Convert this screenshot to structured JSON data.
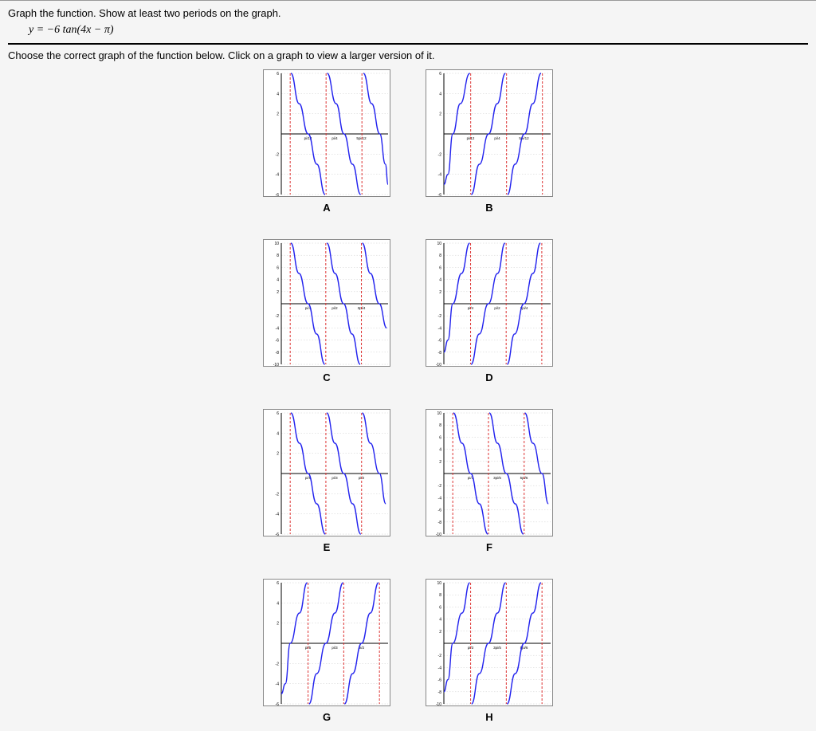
{
  "question": {
    "prompt": "Graph the function. Show at least two periods on the graph.",
    "formula_prefix": "y = ",
    "formula_tan": "−6 tan(4x − π)",
    "instruction": "Choose the correct graph of the function below. Click on a graph to view a larger version of it."
  },
  "options": {
    "A": {
      "label": "A"
    },
    "B": {
      "label": "B"
    },
    "C": {
      "label": "C"
    },
    "D": {
      "label": "D"
    },
    "E": {
      "label": "E"
    },
    "F": {
      "label": "F"
    },
    "G": {
      "label": "G"
    },
    "H": {
      "label": "H"
    }
  },
  "chart_data": [
    {
      "id": "A",
      "type": "line",
      "title": "",
      "xlabel": "",
      "ylabel": "",
      "xlim": [
        0,
        0.78
      ],
      "ylim": [
        -6,
        6
      ],
      "x_ticks": [
        "pi/12",
        "pi/4",
        "5pi/12"
      ],
      "y_ticks": [
        -6,
        -4,
        -2,
        2,
        4,
        6
      ],
      "asymptotes_x": [
        0.065,
        0.327,
        0.589
      ],
      "direction": "decreasing",
      "series": [
        {
          "name": "tan-branch-1",
          "x": [
            0.07,
            0.13,
            0.196,
            0.26,
            0.32
          ],
          "y": [
            6,
            3,
            0,
            -3,
            -6
          ]
        },
        {
          "name": "tan-branch-2",
          "x": [
            0.335,
            0.4,
            0.458,
            0.52,
            0.58
          ],
          "y": [
            6,
            3,
            0,
            -3,
            -6
          ]
        },
        {
          "name": "tan-branch-3",
          "x": [
            0.6,
            0.66,
            0.72,
            0.76,
            0.78
          ],
          "y": [
            6,
            3,
            0,
            -3,
            -5
          ]
        }
      ]
    },
    {
      "id": "B",
      "type": "line",
      "xlim": [
        0,
        0.78
      ],
      "ylim": [
        -6,
        6
      ],
      "x_ticks": [
        "pi/12",
        "pi/4",
        "5pi/12"
      ],
      "y_ticks": [
        -6,
        -4,
        -2,
        2,
        4,
        6
      ],
      "asymptotes_x": [
        0.196,
        0.458,
        0.72
      ],
      "direction": "increasing",
      "series": [
        {
          "name": "tan-branch-0",
          "x": [
            0.0,
            0.03,
            0.065,
            0.12,
            0.19
          ],
          "y": [
            -5,
            -4,
            0,
            3,
            6
          ]
        },
        {
          "name": "tan-branch-1",
          "x": [
            0.2,
            0.26,
            0.327,
            0.39,
            0.45
          ],
          "y": [
            -6,
            -3,
            0,
            3,
            6
          ]
        },
        {
          "name": "tan-branch-2",
          "x": [
            0.465,
            0.52,
            0.589,
            0.65,
            0.71
          ],
          "y": [
            -6,
            -3,
            0,
            3,
            6
          ]
        }
      ]
    },
    {
      "id": "C",
      "type": "line",
      "xlim": [
        0,
        1.57
      ],
      "ylim": [
        -10,
        10
      ],
      "x_ticks": [
        "pi/4",
        "pi/2",
        "3pi/4"
      ],
      "y_ticks": [
        -10,
        -8,
        -6,
        -4,
        -2,
        2,
        4,
        6,
        8,
        10
      ],
      "asymptotes_x": [
        0.131,
        0.654,
        1.178
      ],
      "direction": "decreasing",
      "series": [
        {
          "name": "tan-branch-1",
          "x": [
            0.14,
            0.26,
            0.393,
            0.52,
            0.64
          ],
          "y": [
            10,
            5,
            0,
            -5,
            -10
          ]
        },
        {
          "name": "tan-branch-2",
          "x": [
            0.67,
            0.79,
            0.916,
            1.04,
            1.16
          ],
          "y": [
            10,
            5,
            0,
            -5,
            -10
          ]
        },
        {
          "name": "tan-branch-3",
          "x": [
            1.19,
            1.31,
            1.44,
            1.55
          ],
          "y": [
            10,
            5,
            0,
            -4
          ]
        }
      ]
    },
    {
      "id": "D",
      "type": "line",
      "xlim": [
        0,
        1.57
      ],
      "ylim": [
        -10,
        10
      ],
      "x_ticks": [
        "pi/4",
        "pi/2",
        "3pi/4"
      ],
      "y_ticks": [
        -10,
        -8,
        -6,
        -4,
        -2,
        2,
        4,
        6,
        8,
        10
      ],
      "asymptotes_x": [
        0.393,
        0.916,
        1.44
      ],
      "direction": "increasing",
      "series": [
        {
          "name": "tan-branch-0",
          "x": [
            0.0,
            0.06,
            0.131,
            0.26,
            0.38
          ],
          "y": [
            -8,
            -6,
            0,
            5,
            10
          ]
        },
        {
          "name": "tan-branch-1",
          "x": [
            0.4,
            0.52,
            0.654,
            0.79,
            0.9
          ],
          "y": [
            -10,
            -5,
            0,
            5,
            10
          ]
        },
        {
          "name": "tan-branch-2",
          "x": [
            0.93,
            1.04,
            1.178,
            1.31,
            1.42
          ],
          "y": [
            -10,
            -5,
            0,
            5,
            10
          ]
        }
      ]
    },
    {
      "id": "E",
      "type": "line",
      "xlim": [
        0,
        2.35
      ],
      "ylim": [
        -6,
        6
      ],
      "x_ticks": [
        "pi/5",
        "pi/3",
        "pi/2"
      ],
      "y_ticks": [
        -6,
        -4,
        -2,
        2,
        4,
        6
      ],
      "asymptotes_x": [
        0.196,
        0.981,
        1.767
      ],
      "direction": "decreasing",
      "series": [
        {
          "name": "tan-branch-1",
          "x": [
            0.21,
            0.4,
            0.589,
            0.78,
            0.97
          ],
          "y": [
            6,
            3,
            0,
            -3,
            -6
          ]
        },
        {
          "name": "tan-branch-2",
          "x": [
            1.0,
            1.18,
            1.374,
            1.57,
            1.75
          ],
          "y": [
            6,
            3,
            0,
            -3,
            -6
          ]
        },
        {
          "name": "tan-branch-3",
          "x": [
            1.78,
            1.96,
            2.16,
            2.3
          ],
          "y": [
            6,
            3,
            0,
            -3
          ]
        }
      ]
    },
    {
      "id": "F",
      "type": "line",
      "xlim": [
        0,
        2.35
      ],
      "ylim": [
        -10,
        10
      ],
      "x_ticks": [
        "pi/3",
        "3pi/5",
        "5pi/6"
      ],
      "y_ticks": [
        -10,
        -8,
        -6,
        -4,
        -2,
        2,
        4,
        6,
        8,
        10
      ],
      "asymptotes_x": [
        0.196,
        0.981,
        1.767
      ],
      "direction": "decreasing",
      "series": [
        {
          "name": "tan-branch-1",
          "x": [
            0.21,
            0.4,
            0.589,
            0.78,
            0.97
          ],
          "y": [
            10,
            5,
            0,
            -5,
            -10
          ]
        },
        {
          "name": "tan-branch-2",
          "x": [
            1.0,
            1.18,
            1.374,
            1.57,
            1.75
          ],
          "y": [
            10,
            5,
            0,
            -5,
            -10
          ]
        },
        {
          "name": "tan-branch-3",
          "x": [
            1.78,
            1.96,
            2.16,
            2.3
          ],
          "y": [
            10,
            5,
            0,
            -5
          ]
        }
      ]
    },
    {
      "id": "G",
      "type": "line",
      "xlim": [
        0,
        2.35
      ],
      "ylim": [
        -6,
        6
      ],
      "x_ticks": [
        "pi/5",
        "pi/3",
        "pi/2"
      ],
      "y_ticks": [
        -6,
        -4,
        -2,
        2,
        4,
        6
      ],
      "asymptotes_x": [
        0.589,
        1.374,
        2.16
      ],
      "direction": "increasing",
      "series": [
        {
          "name": "tan-branch-0",
          "x": [
            0.0,
            0.09,
            0.196,
            0.4,
            0.57
          ],
          "y": [
            -5,
            -4,
            0,
            3,
            6
          ]
        },
        {
          "name": "tan-branch-1",
          "x": [
            0.61,
            0.78,
            0.981,
            1.18,
            1.36
          ],
          "y": [
            -6,
            -3,
            0,
            3,
            6
          ]
        },
        {
          "name": "tan-branch-2",
          "x": [
            1.39,
            1.57,
            1.767,
            1.96,
            2.14
          ],
          "y": [
            -6,
            -3,
            0,
            3,
            6
          ]
        }
      ]
    },
    {
      "id": "H",
      "type": "line",
      "xlim": [
        0,
        2.35
      ],
      "ylim": [
        -10,
        10
      ],
      "x_ticks": [
        "pi/3",
        "3pi/5",
        "5pi/6"
      ],
      "y_ticks": [
        -10,
        -8,
        -6,
        -4,
        -2,
        2,
        4,
        6,
        8,
        10
      ],
      "asymptotes_x": [
        0.589,
        1.374,
        2.16
      ],
      "direction": "increasing",
      "series": [
        {
          "name": "tan-branch-0",
          "x": [
            0.0,
            0.09,
            0.196,
            0.4,
            0.57
          ],
          "y": [
            -8,
            -6,
            0,
            5,
            10
          ]
        },
        {
          "name": "tan-branch-1",
          "x": [
            0.61,
            0.78,
            0.981,
            1.18,
            1.36
          ],
          "y": [
            -10,
            -5,
            0,
            5,
            10
          ]
        },
        {
          "name": "tan-branch-2",
          "x": [
            1.39,
            1.57,
            1.767,
            1.96,
            2.14
          ],
          "y": [
            -10,
            -5,
            0,
            5,
            10
          ]
        }
      ]
    }
  ]
}
